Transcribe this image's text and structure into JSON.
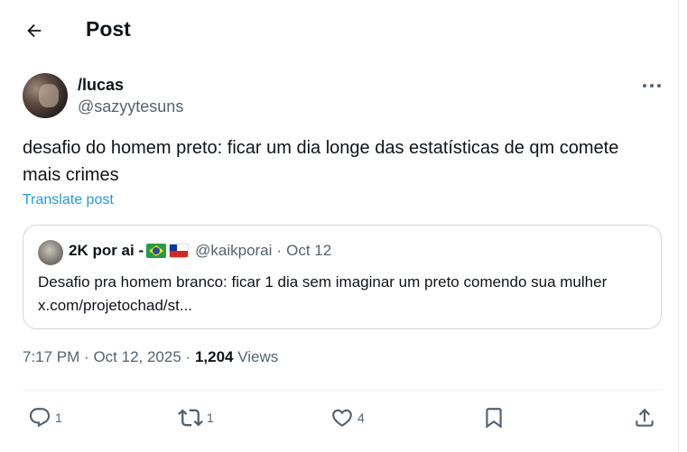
{
  "header": {
    "title": "Post"
  },
  "post": {
    "author": {
      "display_name": "/lucas",
      "handle": "@sazyytesuns"
    },
    "text": "desafio do homem preto: ficar um dia longe das estatísticas de qm comete mais crimes",
    "translate_label": "Translate post",
    "quote": {
      "display_name": "2K por ai -",
      "flags": [
        "brazil-flag",
        "chile-flag"
      ],
      "handle": "@kaikporai",
      "separator": "·",
      "date": "Oct 12",
      "text": "Desafio pra homem branco: ficar 1 dia sem imaginar um preto comendo sua mulher x.com/projetochad/st..."
    },
    "meta": {
      "time": "7:17 PM",
      "separator": "·",
      "date": "Oct 12, 2025",
      "views_count": "1,204",
      "views_label": "Views"
    },
    "actions": {
      "reply": {
        "icon": "reply-icon",
        "count": "1"
      },
      "repost": {
        "icon": "repost-icon",
        "count": "1"
      },
      "like": {
        "icon": "like-icon",
        "count": "4"
      },
      "bookmark": {
        "icon": "bookmark-icon"
      },
      "share": {
        "icon": "share-icon"
      }
    }
  },
  "colors": {
    "text_primary": "#0f1419",
    "text_secondary": "#536471",
    "link": "#1d9bf0",
    "border": "#cfd9de"
  }
}
